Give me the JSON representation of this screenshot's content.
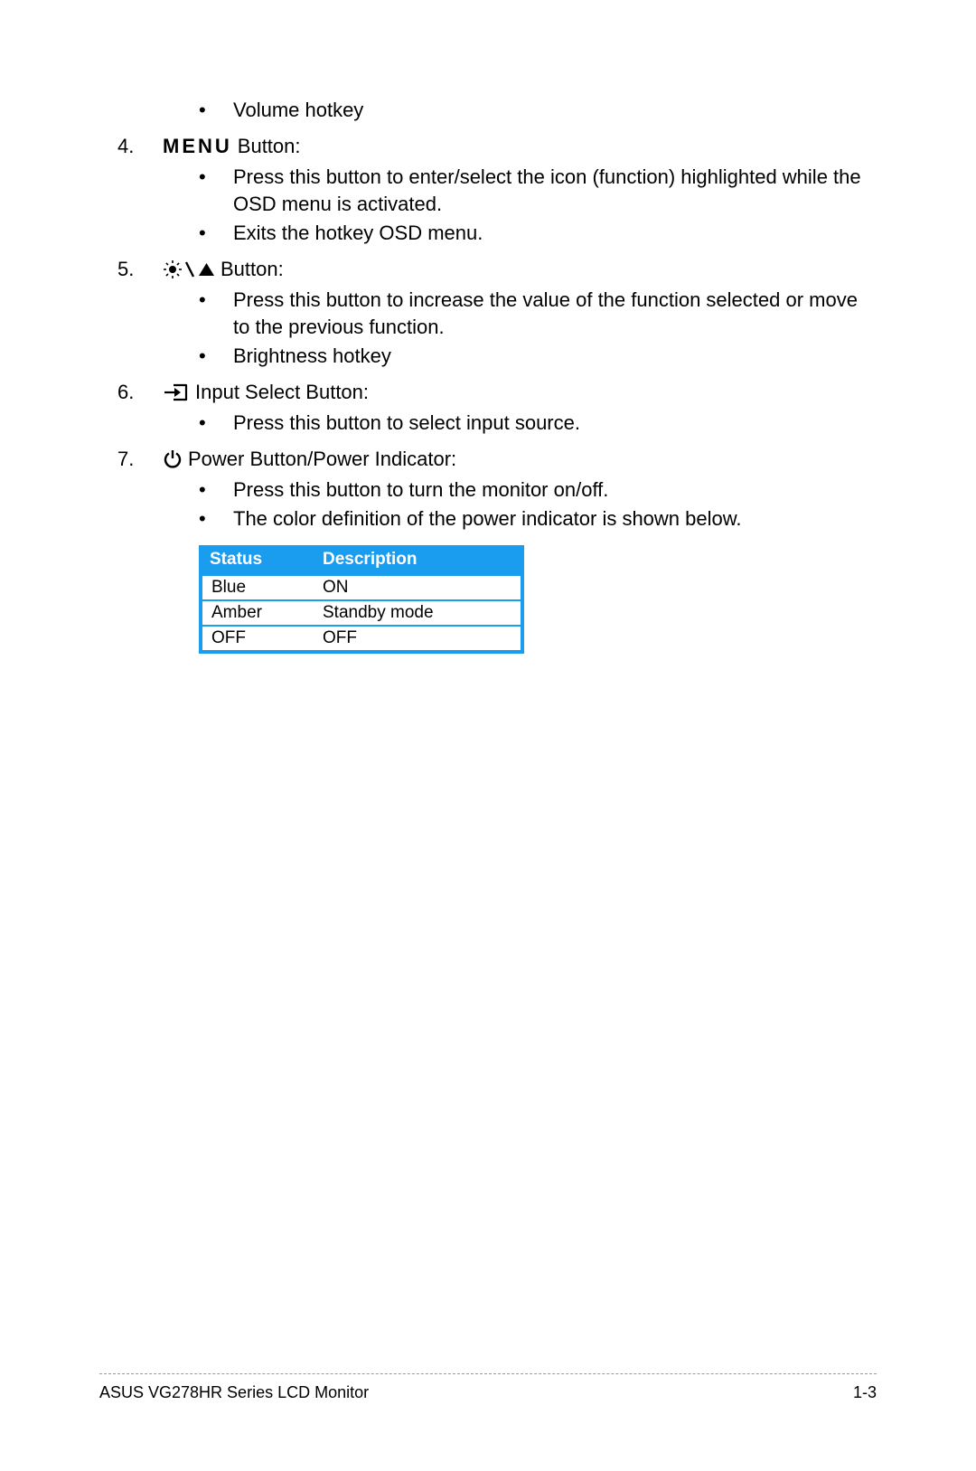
{
  "items": {
    "pre_bullets": [
      "Volume hotkey"
    ],
    "i4": {
      "num": "4.",
      "menu_word": "MENU",
      "label_after": "Button:",
      "bullets": [
        "Press this button to enter/select the icon (function) highlighted while the OSD menu is activated.",
        "Exits the hotkey OSD menu."
      ]
    },
    "i5": {
      "num": "5.",
      "label_after": "Button:",
      "bullets": [
        "Press this button to increase the value of the function selected or move to the previous function.",
        "Brightness hotkey"
      ]
    },
    "i6": {
      "num": "6.",
      "label_after": "Input Select Button:",
      "bullets": [
        "Press this button to select input source."
      ]
    },
    "i7": {
      "num": "7.",
      "label_after": "Power Button/Power Indicator:",
      "bullets": [
        "Press this button to turn the monitor on/off.",
        "The color definition of the power indicator is shown below."
      ]
    }
  },
  "table": {
    "headers": {
      "status": "Status",
      "desc": "Description"
    },
    "rows": [
      {
        "status": "Blue",
        "desc": "ON"
      },
      {
        "status": "Amber",
        "desc": "Standby mode"
      },
      {
        "status": "OFF",
        "desc": "OFF"
      }
    ]
  },
  "footer": {
    "left": "ASUS VG278HR Series LCD Monitor",
    "right": "1-3"
  }
}
